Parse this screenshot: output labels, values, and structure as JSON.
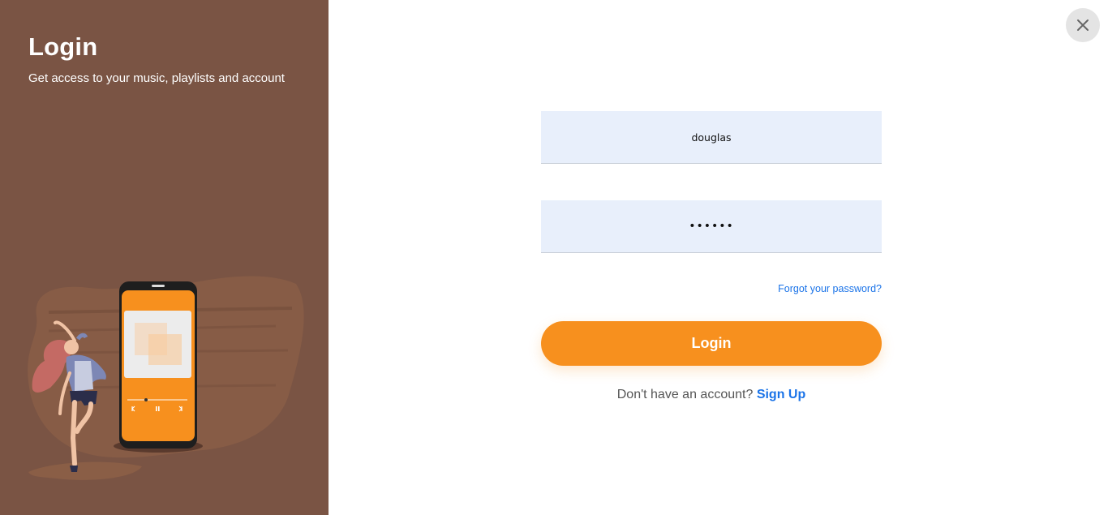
{
  "left_panel": {
    "title": "Login",
    "subtitle": "Get access to your music, playlists and account",
    "background_color": "#7a5444",
    "illustration": "woman-dancing-with-phone-music-player"
  },
  "close_button": {
    "icon": "close-icon"
  },
  "form": {
    "username_value": "douglas",
    "password_value": "••••••",
    "forgot_password_label": "Forgot your password?",
    "login_label": "Login",
    "signup_prompt": "Don't have an account?",
    "signup_label": "Sign Up"
  },
  "colors": {
    "accent": "#f7901e",
    "link": "#1a73e8",
    "input_bg": "#e8effb"
  }
}
